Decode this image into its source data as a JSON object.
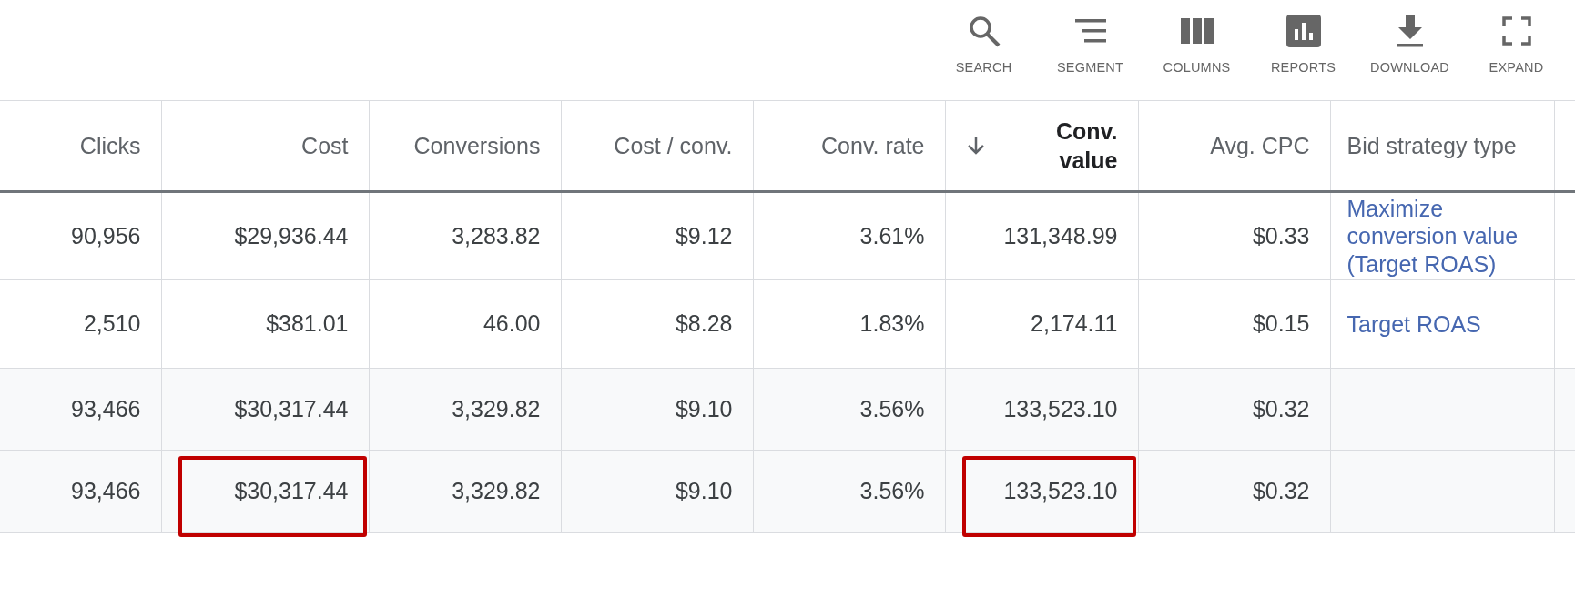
{
  "toolbar": [
    {
      "kind": "search",
      "label": "SEARCH"
    },
    {
      "kind": "segment",
      "label": "SEGMENT"
    },
    {
      "kind": "columns",
      "label": "COLUMNS"
    },
    {
      "kind": "reports",
      "label": "REPORTS"
    },
    {
      "kind": "download",
      "label": "DOWNLOAD"
    },
    {
      "kind": "expand",
      "label": "EXPAND"
    }
  ],
  "table": {
    "columns": [
      {
        "label": "Clicks",
        "sorted": false
      },
      {
        "label": "Cost",
        "sorted": false
      },
      {
        "label": "Conversions",
        "sorted": false
      },
      {
        "label": "Cost / conv.",
        "sorted": false
      },
      {
        "label": "Conv. rate",
        "sorted": false
      },
      {
        "label": "Conv. value",
        "sorted": true
      },
      {
        "label": "Avg. CPC",
        "sorted": false
      },
      {
        "label": "Bid strategy type",
        "sorted": false
      }
    ],
    "rows": [
      {
        "kind": "data",
        "cells": [
          {
            "text": "90,956",
            "kind": "number",
            "highlighted": false
          },
          {
            "text": "$29,936.44",
            "kind": "number",
            "highlighted": false
          },
          {
            "text": "3,283.82",
            "kind": "number",
            "highlighted": false
          },
          {
            "text": "$9.12",
            "kind": "number",
            "highlighted": false
          },
          {
            "text": "3.61%",
            "kind": "number",
            "highlighted": false
          },
          {
            "text": "131,348.99",
            "kind": "number",
            "highlighted": false
          },
          {
            "text": "$0.33",
            "kind": "number",
            "highlighted": false
          },
          {
            "text": "Maximize conversion value (Target ROAS)",
            "kind": "link",
            "highlighted": false
          }
        ]
      },
      {
        "kind": "data",
        "cells": [
          {
            "text": "2,510",
            "kind": "number",
            "highlighted": false
          },
          {
            "text": "$381.01",
            "kind": "number",
            "highlighted": false
          },
          {
            "text": "46.00",
            "kind": "number",
            "highlighted": false
          },
          {
            "text": "$8.28",
            "kind": "number",
            "highlighted": false
          },
          {
            "text": "1.83%",
            "kind": "number",
            "highlighted": false
          },
          {
            "text": "2,174.11",
            "kind": "number",
            "highlighted": false
          },
          {
            "text": "$0.15",
            "kind": "number",
            "highlighted": false
          },
          {
            "text": "Target ROAS",
            "kind": "link",
            "highlighted": false
          }
        ]
      },
      {
        "kind": "total",
        "cells": [
          {
            "text": "93,466",
            "kind": "number",
            "highlighted": false
          },
          {
            "text": "$30,317.44",
            "kind": "number",
            "highlighted": false
          },
          {
            "text": "3,329.82",
            "kind": "number",
            "highlighted": false
          },
          {
            "text": "$9.10",
            "kind": "number",
            "highlighted": false
          },
          {
            "text": "3.56%",
            "kind": "number",
            "highlighted": false
          },
          {
            "text": "133,523.10",
            "kind": "number",
            "highlighted": false
          },
          {
            "text": "$0.32",
            "kind": "number",
            "highlighted": false
          }
        ]
      },
      {
        "kind": "total",
        "cells": [
          {
            "text": "93,466",
            "kind": "number",
            "highlighted": false
          },
          {
            "text": "$30,317.44",
            "kind": "number",
            "highlighted": true
          },
          {
            "text": "3,329.82",
            "kind": "number",
            "highlighted": false
          },
          {
            "text": "$9.10",
            "kind": "number",
            "highlighted": false
          },
          {
            "text": "3.56%",
            "kind": "number",
            "highlighted": false
          },
          {
            "text": "133,523.10",
            "kind": "number",
            "highlighted": true
          },
          {
            "text": "$0.32",
            "kind": "number",
            "highlighted": false
          }
        ]
      }
    ]
  }
}
